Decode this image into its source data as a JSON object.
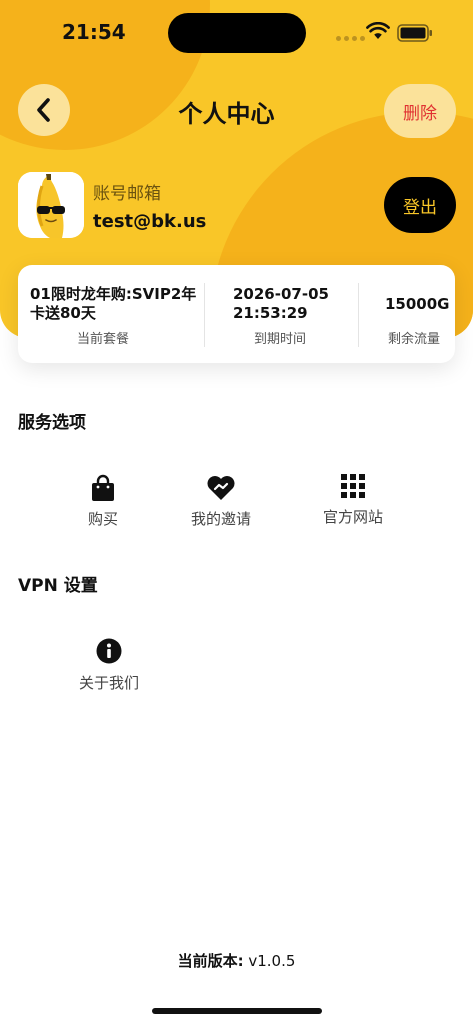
{
  "status_bar": {
    "time": "21:54"
  },
  "header": {
    "title": "个人中心",
    "delete_label": "删除",
    "back_icon": "chevron-left-icon"
  },
  "profile": {
    "account_label": "账号邮箱",
    "email": "test@bk.us",
    "logout_label": "登出",
    "avatar_icon": "banana-sunglasses-avatar"
  },
  "plan": {
    "name": "01限时龙年购:SVIP2年卡送80天",
    "name_caption": "当前套餐",
    "expire_date": "2026-07-05",
    "expire_time": "21:53:29",
    "expire_caption": "到期时间",
    "traffic": "15000G",
    "traffic_caption": "剩余流量"
  },
  "services": {
    "title": "服务选项",
    "items": [
      {
        "label": "购买",
        "icon": "shopping-bag-icon"
      },
      {
        "label": "我的邀请",
        "icon": "heart-handshake-icon"
      },
      {
        "label": "官方网站",
        "icon": "grid-icon"
      }
    ]
  },
  "vpn": {
    "title": "VPN 设置",
    "items": [
      {
        "label": "关于我们",
        "icon": "info-icon"
      }
    ]
  },
  "footer": {
    "version_label": "当前版本:",
    "version_value": "v1.0.5"
  },
  "colors": {
    "accent_yellow": "#f9c628",
    "accent_orange": "#f5b21b",
    "delete_red": "#e03131"
  }
}
